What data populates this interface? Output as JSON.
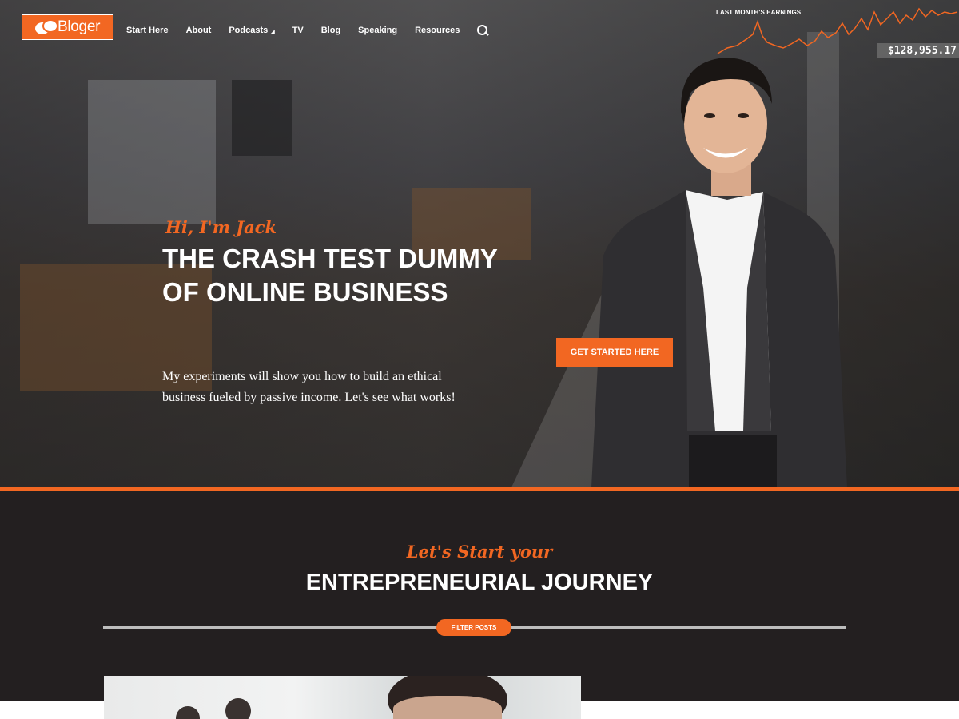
{
  "brand": {
    "logo_text": "Bloger"
  },
  "nav": {
    "items": [
      {
        "label": "Start Here"
      },
      {
        "label": "About"
      },
      {
        "label": "Podcasts",
        "has_dropdown": true
      },
      {
        "label": "TV"
      },
      {
        "label": "Blog"
      },
      {
        "label": "Speaking"
      },
      {
        "label": "Resources"
      }
    ]
  },
  "earnings": {
    "label": "LAST MONTH'S EARNINGS",
    "value": "$128,955.17"
  },
  "hero": {
    "greeting": "Hi, I'm Jack",
    "headline": "THE CRASH TEST DUMMY OF ONLINE BUSINESS",
    "intro": "My experiments will show you how to build an ethical business fueled by passive income. Let's see what works!",
    "cta_label": "GET STARTED HERE"
  },
  "section": {
    "script_title": "Let's Start your",
    "title": "ENTREPRENEURIAL JOURNEY",
    "filter_label": "FILTER POSTS"
  },
  "colors": {
    "accent": "#f26722",
    "dark_bg": "#231f20"
  }
}
